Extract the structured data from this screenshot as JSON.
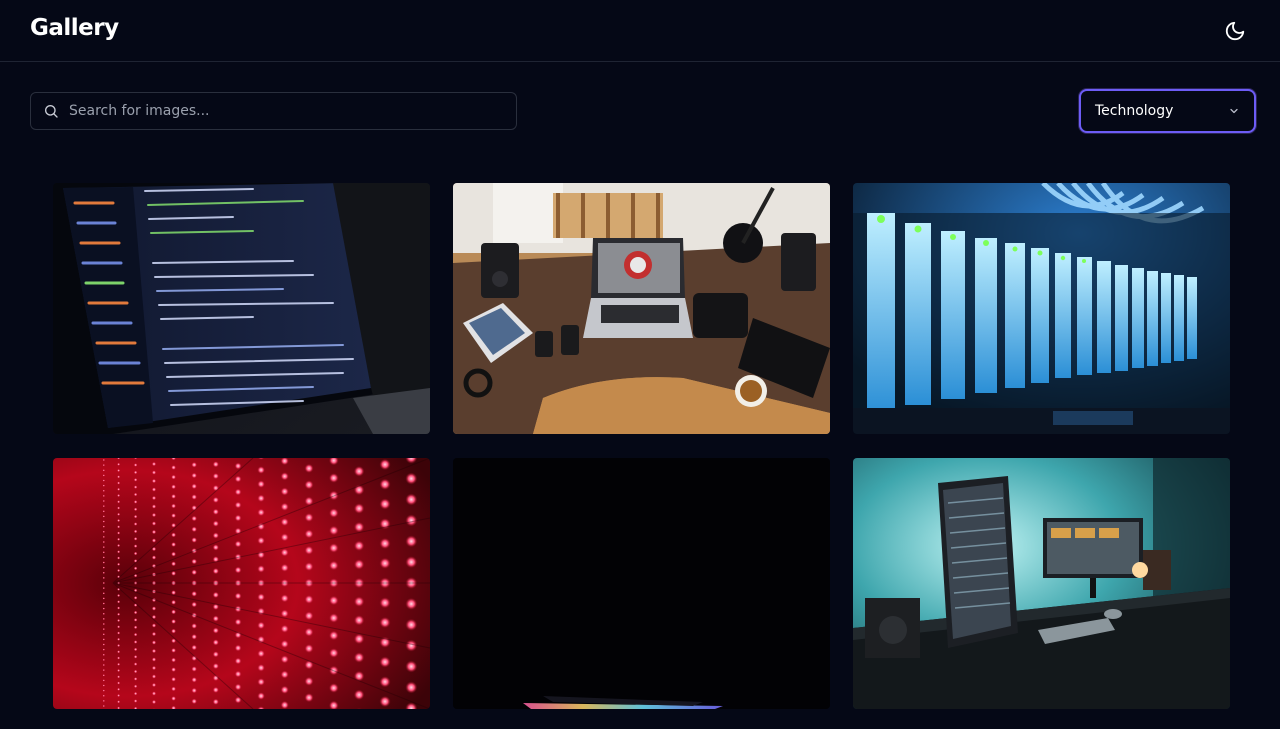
{
  "header": {
    "title": "Gallery",
    "theme_toggle_icon": "moon-icon"
  },
  "search": {
    "placeholder": "Search for images...",
    "value": "",
    "icon": "search-icon"
  },
  "category_select": {
    "selected": "Technology",
    "icon": "chevron-down-icon"
  },
  "colors": {
    "background": "#050816",
    "accent": "#6d5cf6",
    "border": "#2a2f3d"
  },
  "gallery": {
    "images": [
      {
        "subject": "laptop with code editor"
      },
      {
        "subject": "desk with laptop and gadgets"
      },
      {
        "subject": "server rack with blue lights"
      },
      {
        "subject": "red LED matrix"
      },
      {
        "subject": "laptop keyboard in darkness"
      },
      {
        "subject": "desk setup with monitors"
      }
    ]
  }
}
